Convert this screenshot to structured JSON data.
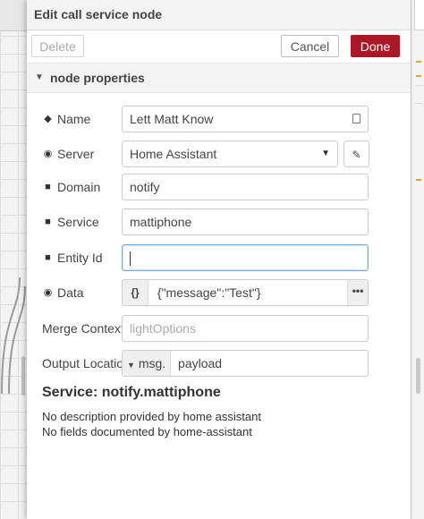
{
  "dialog": {
    "title": "Edit call service node"
  },
  "toolbar": {
    "delete_label": "Delete",
    "cancel_label": "Cancel",
    "done_label": "Done"
  },
  "section": {
    "title": "node properties"
  },
  "fields": {
    "name": {
      "label": "Name",
      "value": "Lett Matt Know"
    },
    "server": {
      "label": "Server",
      "value": "Home Assistant"
    },
    "domain": {
      "label": "Domain",
      "value": "notify"
    },
    "service": {
      "label": "Service",
      "value": "mattiphone"
    },
    "entity_id": {
      "label": "Entity Id",
      "value": ""
    },
    "data": {
      "label": "Data",
      "type_glyph": "{}",
      "value": "{\"message\":\"Test\"}"
    },
    "merge_context": {
      "label": "Merge Context",
      "placeholder": "lightOptions"
    },
    "output_location": {
      "label": "Output Location",
      "prefix": "msg.",
      "value": "payload"
    }
  },
  "service_info": {
    "title": "Service: notify.mattiphone",
    "line1": "No description provided by home assistant",
    "line2": "No fields documented by home-assistant"
  },
  "colors": {
    "accent": "#ad1625",
    "focus_border": "#7fa7d6",
    "header_bg": "#f3f3f3"
  },
  "icons": [
    "tag-icon",
    "server-icon",
    "cube-icon",
    "dot-circle-icon",
    "pencil-icon",
    "ellipsis-icon",
    "caret-down-icon",
    "chevron-down-icon"
  ]
}
